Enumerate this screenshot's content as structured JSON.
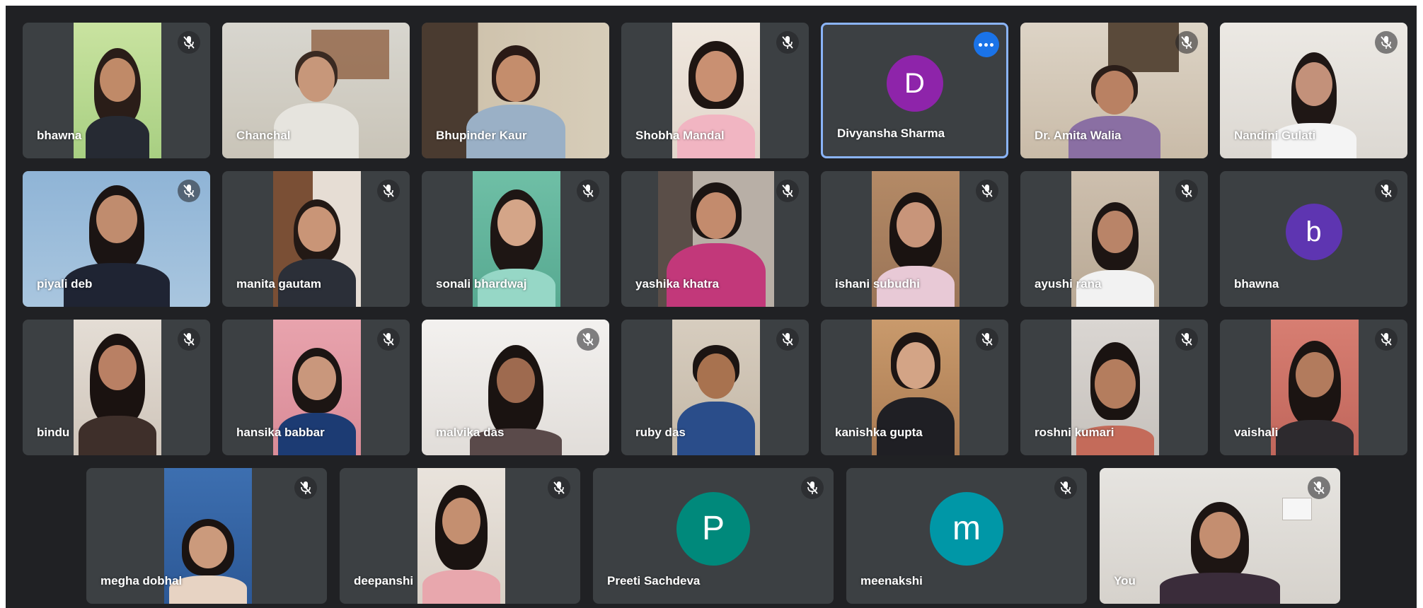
{
  "participants": [
    {
      "name": "bhawna",
      "muted": true
    },
    {
      "name": "Chanchal",
      "muted": false
    },
    {
      "name": "Bhupinder Kaur",
      "muted": false
    },
    {
      "name": "Shobha Mandal",
      "muted": true
    },
    {
      "name": "Divyansha Sharma",
      "muted": false,
      "avatar_letter": "D",
      "avatar_color": "#8e24aa",
      "active": true
    },
    {
      "name": "Dr. Amita Walia",
      "muted": true
    },
    {
      "name": "Nandini Gulati",
      "muted": true
    },
    {
      "name": "piyali deb",
      "muted": true
    },
    {
      "name": "manita gautam",
      "muted": true
    },
    {
      "name": "sonali bhardwaj",
      "muted": true
    },
    {
      "name": "yashika khatra",
      "muted": true
    },
    {
      "name": "ishani subudhi",
      "muted": true
    },
    {
      "name": "ayushi rana",
      "muted": true
    },
    {
      "name": "bhawna",
      "muted": true,
      "avatar_letter": "b",
      "avatar_color": "#5e35b1"
    },
    {
      "name": "bindu",
      "muted": true
    },
    {
      "name": "hansika babbar",
      "muted": true
    },
    {
      "name": "malvika das",
      "muted": true
    },
    {
      "name": "ruby das",
      "muted": true
    },
    {
      "name": "kanishka gupta",
      "muted": true
    },
    {
      "name": "roshni kumari",
      "muted": true
    },
    {
      "name": "vaishali",
      "muted": true
    },
    {
      "name": "megha dobhal",
      "muted": true
    },
    {
      "name": "deepanshi",
      "muted": true
    },
    {
      "name": "Preeti Sachdeva",
      "muted": true,
      "avatar_letter": "P",
      "avatar_color": "#00897b"
    },
    {
      "name": "meenakshi",
      "muted": true,
      "avatar_letter": "m",
      "avatar_color": "#0097a7"
    },
    {
      "name": "You",
      "muted": true
    }
  ],
  "icons": {
    "mic_off": "mic-off-icon",
    "more_options": "more-options-icon"
  },
  "colors": {
    "background": "#202124",
    "tile": "#3c4043",
    "active_border": "#8ab4f8",
    "more_button": "#1a73e8"
  }
}
